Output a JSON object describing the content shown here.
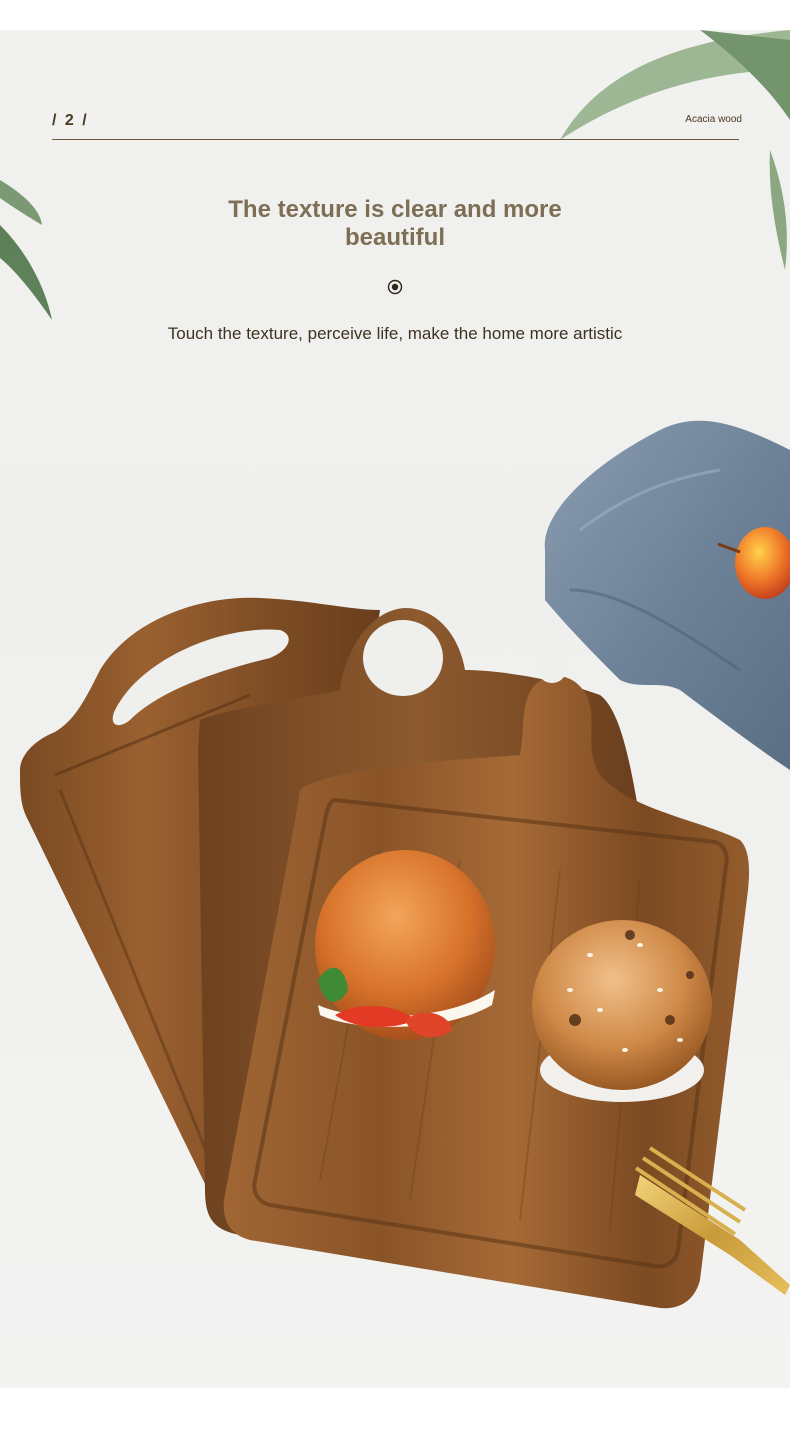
{
  "header": {
    "page_number": "/ 2 /",
    "material": "Acacia wood"
  },
  "headline": {
    "line1": "The texture is clear and more",
    "line2": "beautiful"
  },
  "icons": {
    "divider": "target-icon"
  },
  "subline": "Touch the texture, perceive life, make the home more artistic",
  "colors": {
    "headline": "#7d6e54",
    "text_dark": "#3e3222",
    "wood": "#8a5428",
    "background": "#efefed"
  }
}
